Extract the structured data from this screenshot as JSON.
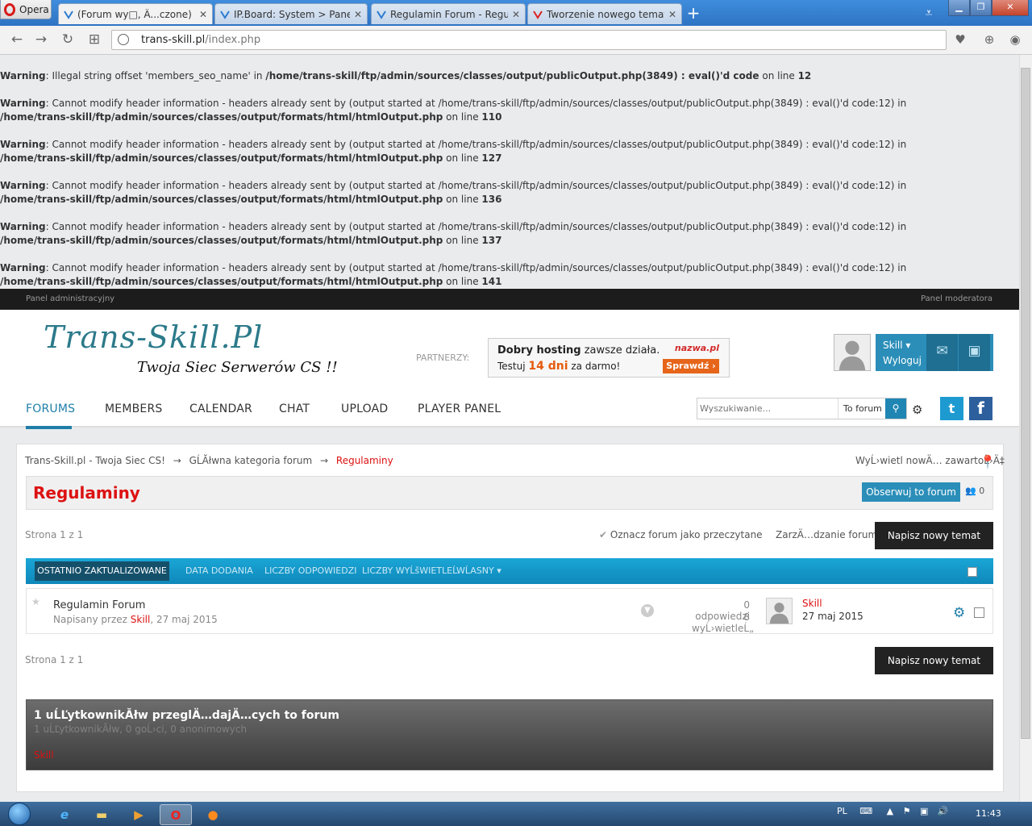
{
  "browser": {
    "menu_label": "Opera",
    "tabs": [
      {
        "label": "(Forum wy□, Ä...czone) Reg",
        "active": true
      },
      {
        "label": "IP.Board: System > Panel k",
        "active": false
      },
      {
        "label": "Regulamin Forum - Regul",
        "active": false
      },
      {
        "label": "Tworzenie nowego tematu",
        "active": false
      }
    ],
    "new_tab": "+",
    "url_host": "trans-skill.pl",
    "url_path": "/index.php"
  },
  "warnings": [
    {
      "label": "Warning",
      "msg": ": Illegal string offset 'members_seo_name' in ",
      "file": "/home/trans-skill/ftp/admin/sources/classes/output/publicOutput.php(3849) : eval()'d code",
      "online": " on line ",
      "line": "12"
    },
    {
      "label": "Warning",
      "msg": ": Cannot modify header information - headers already sent by (output started at /home/trans-skill/ftp/admin/sources/classes/output/publicOutput.php(3849) : eval()'d code:12) in ",
      "file": "/home/trans-skill/ftp/admin/sources/classes/output/formats/html/htmlOutput.php",
      "online": " on line ",
      "line": "110"
    },
    {
      "label": "Warning",
      "msg": ": Cannot modify header information - headers already sent by (output started at /home/trans-skill/ftp/admin/sources/classes/output/publicOutput.php(3849) : eval()'d code:12) in ",
      "file": "/home/trans-skill/ftp/admin/sources/classes/output/formats/html/htmlOutput.php",
      "online": " on line ",
      "line": "127"
    },
    {
      "label": "Warning",
      "msg": ": Cannot modify header information - headers already sent by (output started at /home/trans-skill/ftp/admin/sources/classes/output/publicOutput.php(3849) : eval()'d code:12) in ",
      "file": "/home/trans-skill/ftp/admin/sources/classes/output/formats/html/htmlOutput.php",
      "online": " on line ",
      "line": "136"
    },
    {
      "label": "Warning",
      "msg": ": Cannot modify header information - headers already sent by (output started at /home/trans-skill/ftp/admin/sources/classes/output/publicOutput.php(3849) : eval()'d code:12) in ",
      "file": "/home/trans-skill/ftp/admin/sources/classes/output/formats/html/htmlOutput.php",
      "online": " on line ",
      "line": "137"
    },
    {
      "label": "Warning",
      "msg": ": Cannot modify header information - headers already sent by (output started at /home/trans-skill/ftp/admin/sources/classes/output/publicOutput.php(3849) : eval()'d code:12) in ",
      "file": "/home/trans-skill/ftp/admin/sources/classes/output/formats/html/htmlOutput.php",
      "online": " on line ",
      "line": "141"
    }
  ],
  "adminbar": {
    "left": "Panel administracyjny",
    "right": "Panel moderatora"
  },
  "header": {
    "logo_title": "Trans-Skill.Pl",
    "logo_sub": "Twoja Siec Serwerów CS !!",
    "partners_label": "PARTNERZY:",
    "banner": {
      "line1_bold": "Dobry hosting",
      "line1_rest": " zawsze działa.",
      "line2_pre": "Testuj ",
      "line2_bold": "14 dni",
      "line2_post": " za darmo!",
      "brand": "nazwa.pl",
      "button": "Sprawdź ›"
    },
    "user": {
      "name": "Skill ▾",
      "logout": "Wyloguj"
    }
  },
  "nav": {
    "items": [
      "FORUMS",
      "MEMBERS",
      "CALENDAR",
      "CHAT",
      "UPLOAD",
      "PLAYER PANEL"
    ],
    "search_placeholder": "Wyszukiwanie...",
    "search_scope": "To forum",
    "twitter": "t",
    "facebook": "f"
  },
  "breadcrumb": {
    "items": [
      "Trans-Skill.pl - Twoja Siec CS!",
      "GĹĂłwna kategoria forum",
      "Regulaminy"
    ],
    "sep": "→"
  },
  "new_content": "WyĹ›wietl nowÄ… zawartoĹ›Ä‡",
  "forum": {
    "title": "Regulaminy",
    "follow": "Obserwuj to forum",
    "followers": "0",
    "page_info": "Strona 1 z 1",
    "mark_read": "Oznacz forum jako przeczytane",
    "manage": "ZarzÄ…dzanie forum",
    "new_topic": "Napisz nowy temat"
  },
  "sort": {
    "active": "OSTATNIO ZAKTUALIZOWANE",
    "options": [
      "DATA DODANIA",
      "LICZBY ODPOWIEDZI",
      "LICZBY WYĹšWIETLEĹ",
      "WĹASNY ▾"
    ]
  },
  "topic": {
    "title": "Regulamin Forum",
    "meta_pre": "Napisany przez ",
    "author": "Skill",
    "meta_post": ", 27 maj 2015",
    "replies": "0 odpowiedzi",
    "views": "8 wyĹ›wietleĹ„",
    "last_user": "Skill",
    "last_date": "27 maj 2015"
  },
  "viewers": {
    "title": "1 uĹĽytkownikĂłw przeglÄ…dajÄ…cych to forum",
    "sub": "1 uĹĽytkownikĂłw, 0 goĹ›ci, 0 anonimowych",
    "user": "Skill"
  },
  "taskbar": {
    "lang": "PL",
    "time": "11:43"
  },
  "colors": {
    "accent": "#1e7ea8",
    "title_red": "#dd1111",
    "sortbar": "#1aa6d6"
  }
}
